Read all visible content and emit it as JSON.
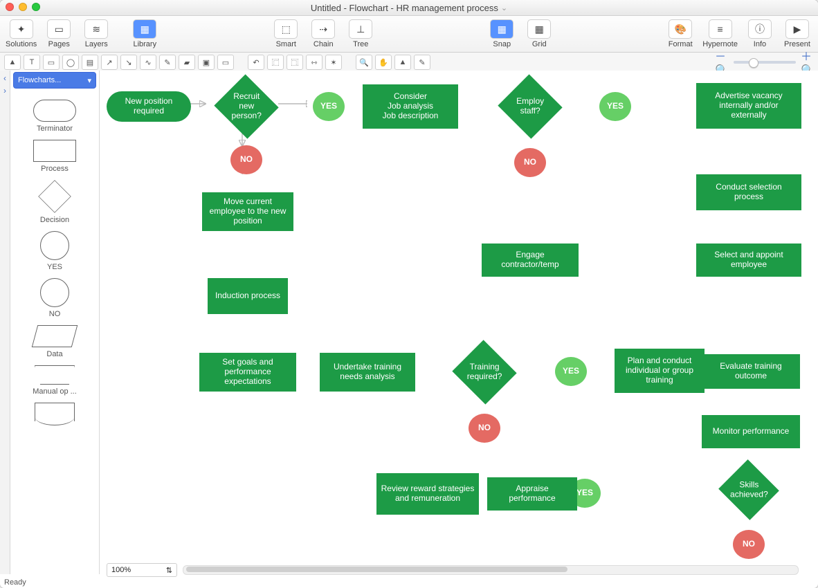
{
  "window": {
    "title": "Untitled - Flowchart - HR management process"
  },
  "toolbar": {
    "solutions": "Solutions",
    "pages": "Pages",
    "layers": "Layers",
    "library": "Library",
    "smart": "Smart",
    "chain": "Chain",
    "tree": "Tree",
    "snap": "Snap",
    "grid": "Grid",
    "format": "Format",
    "hypernote": "Hypernote",
    "info": "Info",
    "present": "Present"
  },
  "library_selector": "Flowcharts...",
  "shapes": {
    "terminator": "Terminator",
    "process": "Process",
    "decision": "Decision",
    "yes": "YES",
    "no": "NO",
    "data": "Data",
    "manual": "Manual op ...",
    "document": ""
  },
  "nodes": {
    "new_position": "New position required",
    "recruit": "Recruit new person?",
    "yes1": "YES",
    "no1": "NO",
    "consider": "Consider\nJob analysis\nJob description",
    "employ": "Employ staff?",
    "yes2": "YES",
    "no2": "NO",
    "advertise": "Advertise vacancy internally and/or externally",
    "conduct_sel": "Conduct selection process",
    "select_appoint": "Select and appoint employee",
    "engage": "Engage contractor/temp",
    "move_current": "Move current employee to the new position",
    "induction": "Induction process",
    "set_goals": "Set goals and performance expectations",
    "undertake": "Undertake training needs analysis",
    "training_req": "Training required?",
    "yes3": "YES",
    "no3": "NO",
    "plan_conduct": "Plan and conduct individual or group training",
    "evaluate": "Evaluate training outcome",
    "monitor": "Monitor performance",
    "skills": "Skills achieved?",
    "yes4": "YES",
    "appraise": "Appraise performance",
    "review_reward": "Review reward strategies and remuneration",
    "no4": "NO"
  },
  "zoom": "100%",
  "status": "Ready"
}
